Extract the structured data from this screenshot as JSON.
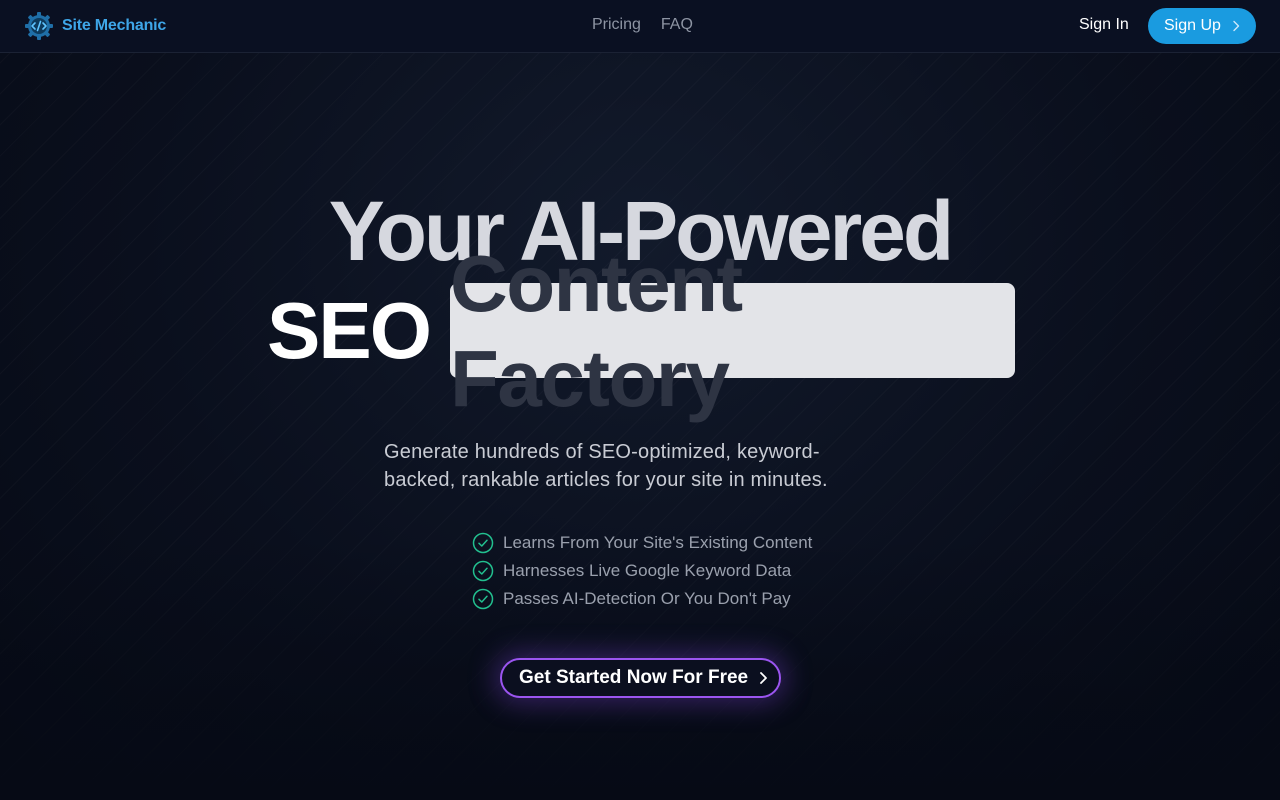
{
  "header": {
    "brand_name": "Site Mechanic",
    "brand_icon": "gear-code-icon",
    "nav": [
      {
        "label": "Pricing"
      },
      {
        "label": "FAQ"
      }
    ],
    "sign_in_label": "Sign In",
    "sign_up_label": "Sign Up"
  },
  "hero": {
    "line1": "Your AI-Powered",
    "line2_plain": "SEO",
    "line2_highlight": "Content Factory",
    "subtitle": "Generate hundreds of SEO-optimized, keyword-backed, rankable articles for your site in minutes.",
    "features": [
      {
        "label": "Learns From Your Site's Existing Content",
        "icon": "check-circle-icon"
      },
      {
        "label": "Harnesses Live Google Keyword Data",
        "icon": "check-circle-icon"
      },
      {
        "label": "Passes AI-Detection Or You Don't Pay",
        "icon": "check-circle-icon"
      }
    ],
    "cta_label": "Get Started Now For Free"
  },
  "colors": {
    "accent_blue": "#1a9be0",
    "brand_text": "#3ea6e8",
    "check_green": "#22c08f",
    "cta_border": "#9b55f0",
    "background": "#070b17"
  }
}
